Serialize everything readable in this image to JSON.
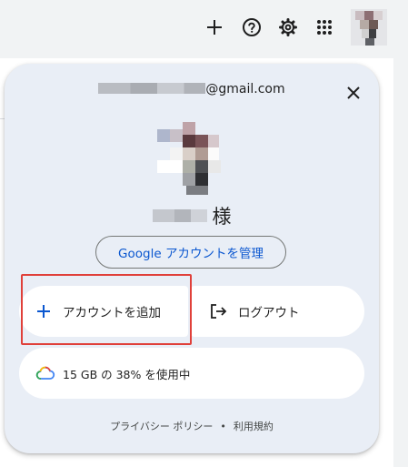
{
  "account_panel": {
    "email_suffix": "@gmail.com",
    "greeting_suffix": "様",
    "manage_account_label": "Google アカウントを管理",
    "add_account_label": "アカウントを追加",
    "logout_label": "ログアウト",
    "storage_label": "15 GB の 38% を使用中",
    "storage_used_fraction": 0.38,
    "privacy_label": "プライバシー ポリシー",
    "footer_separator": "•",
    "terms_label": "利用規約"
  },
  "icons": {
    "top_bar": [
      "plus-icon",
      "help-icon",
      "gear-icon",
      "apps-grid-icon"
    ],
    "panel": [
      "close-icon",
      "plus-icon",
      "logout-icon",
      "cloud-icon"
    ]
  },
  "colors": {
    "panel_background": "#e9eef6",
    "link_blue": "#0b57d0",
    "highlight_red": "#e0403a"
  }
}
